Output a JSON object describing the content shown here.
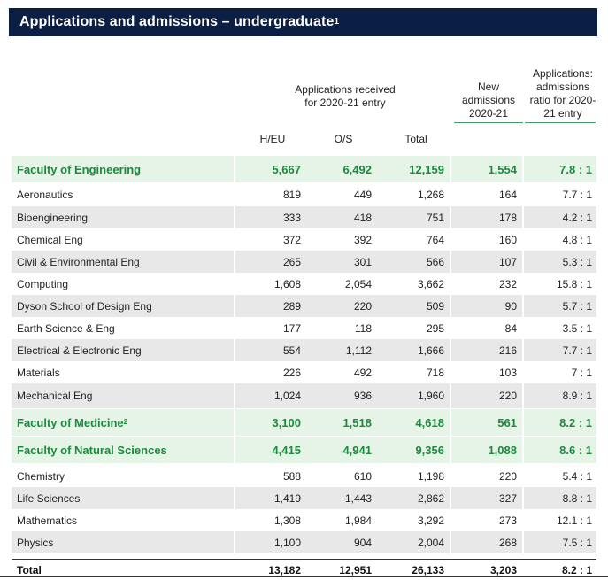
{
  "title": "Applications and admissions – undergraduate",
  "title_footnote": "1",
  "headers": {
    "applications_received": "Applications received for 2020-21 entry",
    "new_admissions": "New admissions 2020-21",
    "ratio": "Applications: admissions ratio for 2020-21 entry",
    "heu": "H/EU",
    "os": "O/S",
    "total": "Total"
  },
  "rows": [
    {
      "name": "Faculty of Engineering",
      "heu": "5,667",
      "os": "6,492",
      "total": "12,159",
      "adm": "1,554",
      "ratio": "7.8 : 1",
      "type": "fac"
    },
    {
      "name": "Aeronautics",
      "heu": "819",
      "os": "449",
      "total": "1,268",
      "adm": "164",
      "ratio": "7.7 : 1",
      "type": "plain"
    },
    {
      "name": "Bioengineering",
      "heu": "333",
      "os": "418",
      "total": "751",
      "adm": "178",
      "ratio": "4.2 : 1",
      "type": "grey"
    },
    {
      "name": "Chemical Eng",
      "heu": "372",
      "os": "392",
      "total": "764",
      "adm": "160",
      "ratio": "4.8 : 1",
      "type": "plain"
    },
    {
      "name": "Civil & Environmental Eng",
      "heu": "265",
      "os": "301",
      "total": "566",
      "adm": "107",
      "ratio": "5.3 : 1",
      "type": "grey"
    },
    {
      "name": "Computing",
      "heu": "1,608",
      "os": "2,054",
      "total": "3,662",
      "adm": "232",
      "ratio": "15.8 : 1",
      "type": "plain"
    },
    {
      "name": "Dyson School of Design Eng",
      "heu": "289",
      "os": "220",
      "total": "509",
      "adm": "90",
      "ratio": "5.7 : 1",
      "type": "grey"
    },
    {
      "name": "Earth Science & Eng",
      "heu": "177",
      "os": "118",
      "total": "295",
      "adm": "84",
      "ratio": "3.5 : 1",
      "type": "plain"
    },
    {
      "name": "Electrical & Electronic Eng",
      "heu": "554",
      "os": "1,112",
      "total": "1,666",
      "adm": "216",
      "ratio": "7.7 : 1",
      "type": "grey"
    },
    {
      "name": "Materials",
      "heu": "226",
      "os": "492",
      "total": "718",
      "adm": "103",
      "ratio": "7 : 1",
      "type": "plain"
    },
    {
      "name": "Mechanical Eng",
      "heu": "1,024",
      "os": "936",
      "total": "1,960",
      "adm": "220",
      "ratio": "8.9 : 1",
      "type": "grey"
    },
    {
      "name": "Faculty of Medicine",
      "footnote": "2",
      "heu": "3,100",
      "os": "1,518",
      "total": "4,618",
      "adm": "561",
      "ratio": "8.2 : 1",
      "type": "fac"
    },
    {
      "name": "Faculty of Natural Sciences",
      "heu": "4,415",
      "os": "4,941",
      "total": "9,356",
      "adm": "1,088",
      "ratio": "8.6 : 1",
      "type": "fac"
    },
    {
      "name": "Chemistry",
      "heu": "588",
      "os": "610",
      "total": "1,198",
      "adm": "220",
      "ratio": "5.4 : 1",
      "type": "plain"
    },
    {
      "name": "Life Sciences",
      "heu": "1,419",
      "os": "1,443",
      "total": "2,862",
      "adm": "327",
      "ratio": "8.8 : 1",
      "type": "grey"
    },
    {
      "name": "Mathematics",
      "heu": "1,308",
      "os": "1,984",
      "total": "3,292",
      "adm": "273",
      "ratio": "12.1 : 1",
      "type": "plain"
    },
    {
      "name": "Physics",
      "heu": "1,100",
      "os": "904",
      "total": "2,004",
      "adm": "268",
      "ratio": "7.5 : 1",
      "type": "grey"
    },
    {
      "name": "Total",
      "heu": "13,182",
      "os": "12,951",
      "total": "26,133",
      "adm": "3,203",
      "ratio": "8.2 : 1",
      "type": "total"
    }
  ]
}
